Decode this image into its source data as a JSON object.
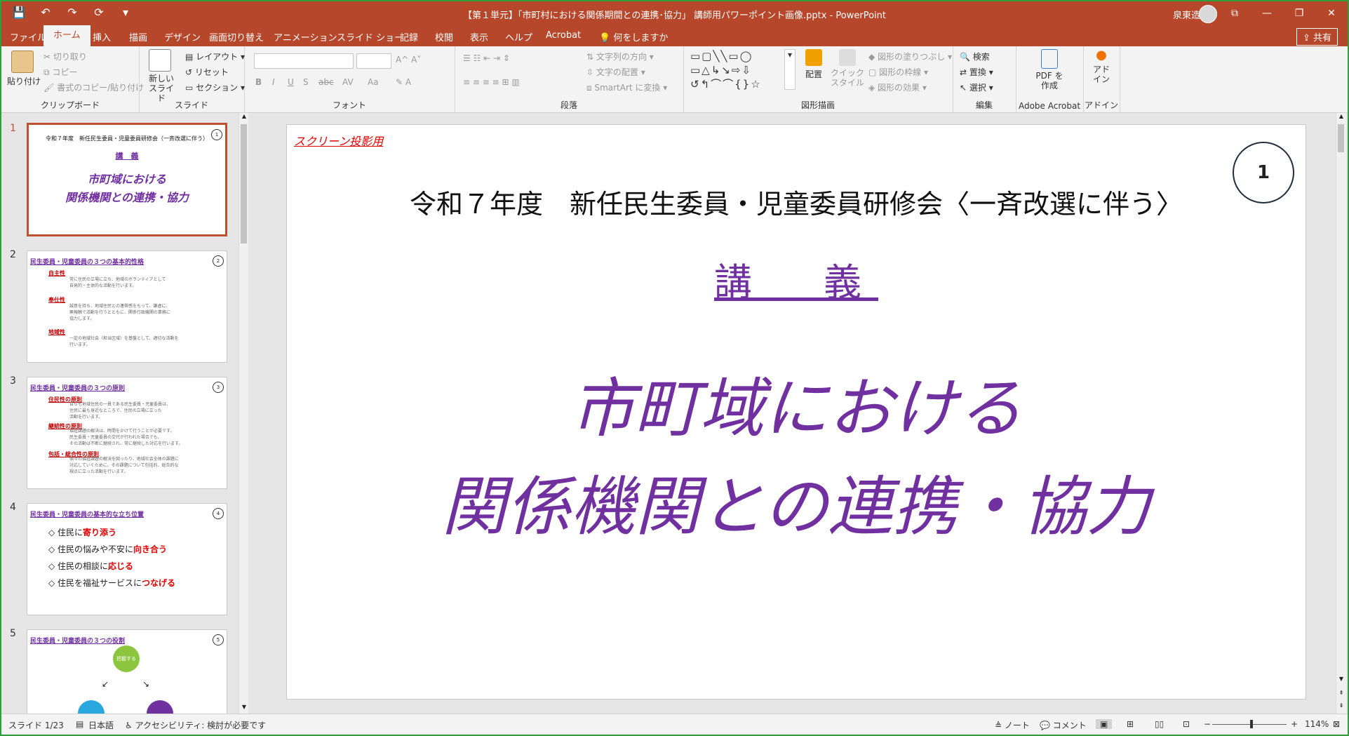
{
  "window": {
    "title": "【第１単元】「市町村における関係期間との連携･協力」 講師用パワーポイント画像.pptx  -  PowerPoint",
    "user": "泉東造",
    "controls": [
      "⧉",
      "—",
      "❐",
      "✕"
    ]
  },
  "qat": [
    "💾",
    "↶",
    "↷",
    "⟳",
    "▾"
  ],
  "tabs": [
    "ファイル",
    "ホーム",
    "挿入",
    "描画",
    "デザイン",
    "画面切り替え",
    "アニメーション",
    "スライド ショー",
    "記録",
    "校閲",
    "表示",
    "ヘルプ",
    "Acrobat",
    "何をしますか"
  ],
  "share_label": "共有",
  "ribbon": {
    "clipboard": {
      "paste": "貼り付け",
      "cut": "切り取り",
      "copy": "コピー",
      "format_copy": "書式のコピー/貼り付け",
      "group": "クリップボード"
    },
    "slides": {
      "new_slide": "新しい スライド",
      "layout": "レイアウト",
      "reset": "リセット",
      "section": "セクション",
      "group": "スライド"
    },
    "font": {
      "group": "フォント",
      "bold": "B",
      "italic": "I",
      "underline": "U",
      "shadow": "S",
      "strike": "abc",
      "spacing": "AV",
      "case": "Aa"
    },
    "paragraph": {
      "group": "段落",
      "text_direction": "文字列の方向",
      "align_text": "文字の配置",
      "smartart": "SmartArt に変換"
    },
    "drawing": {
      "group": "図形描画",
      "arrange": "配置",
      "quick_styles": "クイック スタイル",
      "fill": "図形の塗りつぶし",
      "outline": "図形の枠線",
      "effects": "図形の効果"
    },
    "editing": {
      "group": "編集",
      "find": "検索",
      "replace": "置換",
      "select": "選択"
    },
    "acrobat": {
      "group": "Adobe Acrobat",
      "pdf": "PDF を作成"
    },
    "addin": {
      "group": "アドイン",
      "addin": "アド イン"
    }
  },
  "thumbnails": [
    {
      "num": "1",
      "header": "令和７年度　新任民生委員・児童委員研修会（一斉改選に伴う）",
      "lecture": "講　義",
      "line1": "市町域における",
      "line2": "関係機関との連携・協力",
      "badge": "1"
    },
    {
      "num": "2",
      "header": "民生委員・児童委員の３つの基本的性格",
      "badge": "2",
      "items": [
        {
          "label": "自主性",
          "text": "常に住民の立場に立ち、地域のボランティアとして\n自発的・主体的な活動を行います。"
        },
        {
          "label": "奉仕性",
          "text": "誠意を持ち、地域住民との連帯感をもって、謙虚に、\n無報酬で活動を行うとともに、関係行政機関の業務に\n協力します。"
        },
        {
          "label": "地域性",
          "text": "一定の地域社会（担当区域）を基盤として、適切な活動を\n行います。"
        }
      ]
    },
    {
      "num": "3",
      "header": "民生委員・児童委員の３つの原則",
      "badge": "3",
      "items": [
        {
          "label": "住民性の原則",
          "text": "自らも地域住民の一員である民生委員・児童委員は、\n住民に最も身近なところで、住民の立場に立った\n活動を行います。"
        },
        {
          "label": "継続性の原則",
          "text": "福祉課題の解決は、時間をかけて行うことが必要です。\n民生委員・児童委員の交代が行われた場合でも、\nその活動は不断に継続され、常に継続した対応を行います。"
        },
        {
          "label": "包括・総合性の原則",
          "text": "個々の福祉課題の解決を図ったり、地域社会全体の課題に\n対応していくために、その課題について包括的、総合的な\n視点に立った活動を行います。"
        }
      ]
    },
    {
      "num": "4",
      "header": "民生委員・児童委員の基本的な立ち位置",
      "badge": "4",
      "lines": [
        {
          "pre": "◇ 住民に",
          "em": "寄り添う"
        },
        {
          "pre": "◇ 住民の悩みや不安に",
          "em": "向き合う"
        },
        {
          "pre": "◇ 住民の相談に",
          "em": "応じる"
        },
        {
          "pre": "◇ 住民を福祉サービスに",
          "em": "つなげる"
        }
      ]
    },
    {
      "num": "5",
      "header": "民生委員・児童委員の３つの役割",
      "badge": "5",
      "node": "把握する"
    }
  ],
  "slide": {
    "projection_note": "スクリーン投影用",
    "number": "1",
    "title": "令和７年度　新任民生委員・児童委員研修会〈一斉改選に伴う〉",
    "lecture": "講　義",
    "main_line1": "市町域における",
    "main_line2": "関係機関との連携・協力"
  },
  "status": {
    "slide_count": "スライド 1/23",
    "language": "日本語",
    "accessibility": "アクセシビリティ: 検討が必要です",
    "notes": "ノート",
    "comments": "コメント",
    "zoom": "114%"
  },
  "colors": {
    "accent": "#b7472a",
    "slide_purple": "#7030a0",
    "red": "#e00000"
  }
}
